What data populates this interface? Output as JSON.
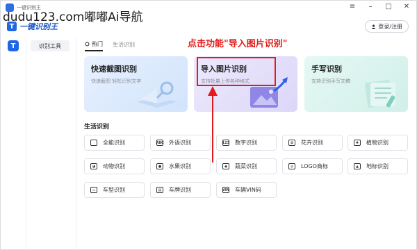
{
  "titlebar": {
    "title": "一键识别王"
  },
  "watermark": "dudu123.com嘟嘟Ai导航",
  "header": {
    "brand": "一键识别王",
    "login_label": "登录/注册"
  },
  "window_controls": {
    "menu": "≡",
    "minimize": "–",
    "maximize": "□",
    "close": "✕"
  },
  "sidemenu": {
    "item": "识别工具"
  },
  "tabs": [
    {
      "label": "热门",
      "active": true
    },
    {
      "label": "生活识别",
      "active": false
    }
  ],
  "annotation": "点击功能\"导入图片识别\"",
  "cards": [
    {
      "title": "快速截图识别",
      "subtitle": "快速截图 轻松识别文字"
    },
    {
      "title": "导入图片识别",
      "subtitle": "支持批量上传各种格式"
    },
    {
      "title": "手写识别",
      "subtitle": "支持识别手写文稿"
    }
  ],
  "section_title": "生活识别",
  "grid": [
    {
      "label": "全能识别",
      "icon": "scan-icon"
    },
    {
      "label": "外语识别",
      "icon": "abc-icon"
    },
    {
      "label": "数字识别",
      "icon": "number-icon"
    },
    {
      "label": "花卉识别",
      "icon": "flower-icon"
    },
    {
      "label": "植物识别",
      "icon": "plant-icon"
    },
    {
      "label": "动物识别",
      "icon": "animal-icon"
    },
    {
      "label": "水果识别",
      "icon": "fruit-icon"
    },
    {
      "label": "蔬菜识别",
      "icon": "vegetable-icon"
    },
    {
      "label": "LOGO商标",
      "icon": "logo-icon"
    },
    {
      "label": "地标识别",
      "icon": "landmark-icon"
    },
    {
      "label": "车型识别",
      "icon": "car-icon"
    },
    {
      "label": "车牌识别",
      "icon": "plate-icon"
    },
    {
      "label": "车辆VIN码",
      "icon": "vin-icon"
    }
  ],
  "colors": {
    "accent": "#1e66e6",
    "annotation": "#e31b1b"
  }
}
